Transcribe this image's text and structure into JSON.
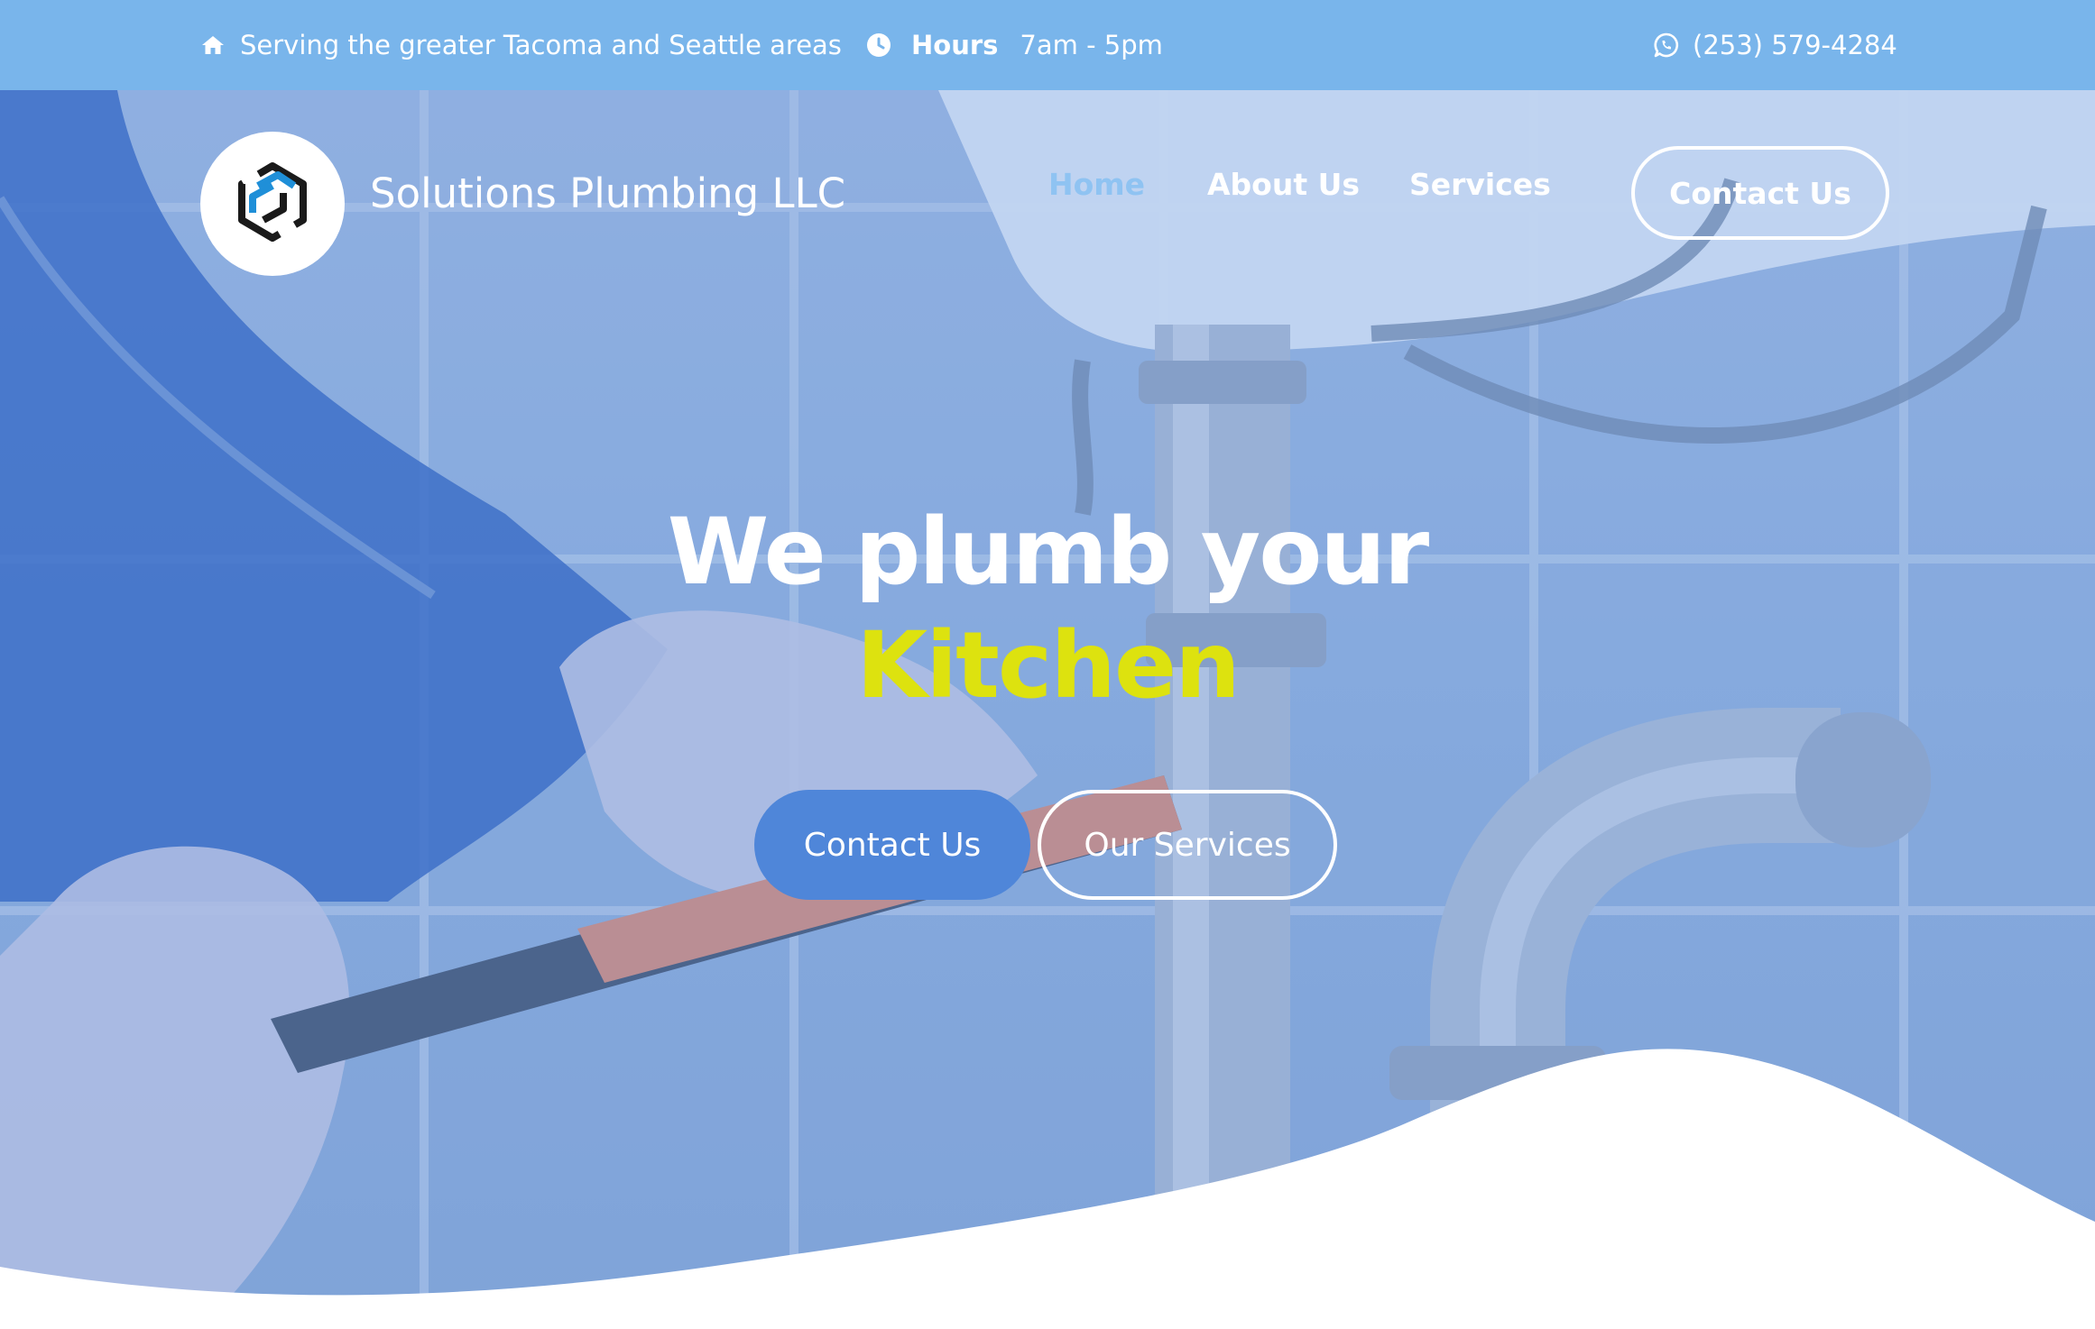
{
  "colors": {
    "topbar_bg": "#79b5eb",
    "accent_yellow": "#dde20f",
    "nav_active": "#8fc3f2",
    "primary_button": "#4f86d9"
  },
  "topbar": {
    "area_icon": "home-icon",
    "area_text": "Serving the greater Tacoma and Seattle areas",
    "hours_icon": "clock-icon",
    "hours_label": "Hours",
    "hours_value": "7am - 5pm",
    "phone_icon": "whatsapp-icon",
    "phone": "(253) 579-4284"
  },
  "header": {
    "logo_icon": "hexagon-logo-icon",
    "brand_name": "Solutions Plumbing LLC",
    "nav": [
      {
        "label": "Home",
        "active": true
      },
      {
        "label": "About Us",
        "active": false
      },
      {
        "label": "Services",
        "active": false
      }
    ],
    "contact_button": "Contact Us"
  },
  "hero": {
    "headline_line1": "We plumb your",
    "headline_line2": "Kitchen",
    "primary_cta": "Contact Us",
    "secondary_cta": "Our Services"
  }
}
